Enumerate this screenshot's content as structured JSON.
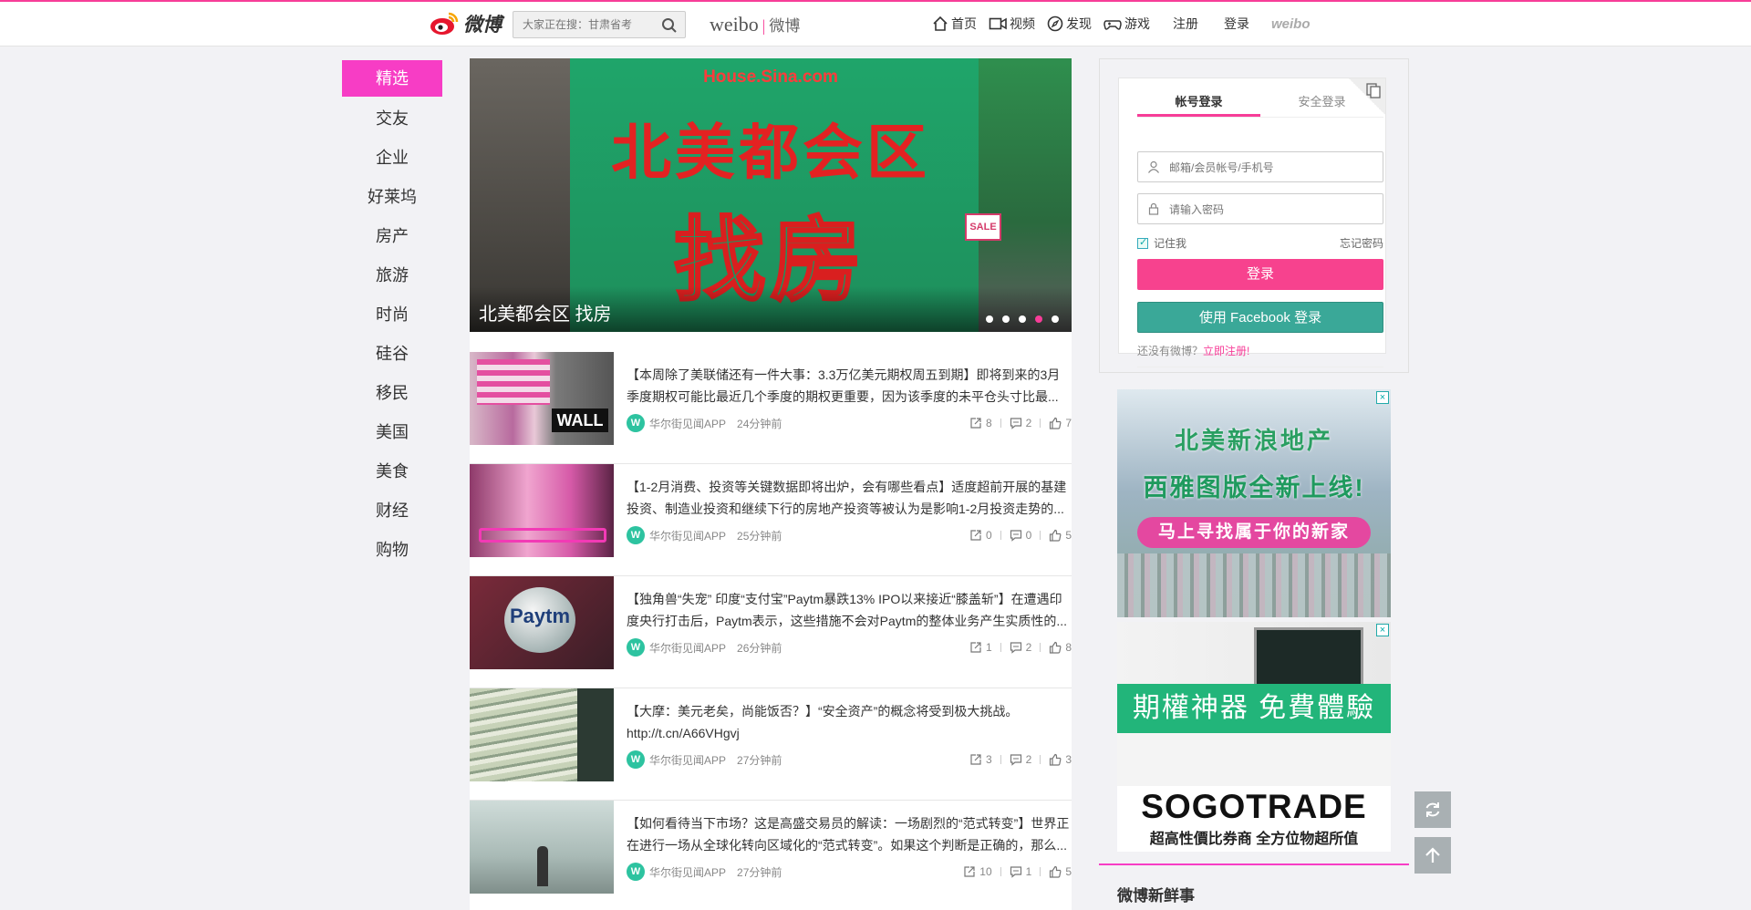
{
  "header": {
    "logo_text": "微博",
    "search_placeholder": "大家正在搜：甘肃省考",
    "brand_en": "weibo",
    "brand_cn": "微博",
    "nav": [
      {
        "label": "首页",
        "icon": "home-icon"
      },
      {
        "label": "视频",
        "icon": "video-icon"
      },
      {
        "label": "发现",
        "icon": "compass-icon"
      },
      {
        "label": "游戏",
        "icon": "gamepad-icon"
      }
    ],
    "register": "注册",
    "login": "登录",
    "small_logo": "weibo"
  },
  "categories": [
    "精选",
    "交友",
    "企业",
    "好莱坞",
    "房产",
    "旅游",
    "时尚",
    "硅谷",
    "移民",
    "美国",
    "美食",
    "财经",
    "购物"
  ],
  "banner": {
    "site": "House.Sina.com",
    "title_line1": "北美都会区",
    "title_line2": "找房",
    "sale": "SALE",
    "caption": "北美都会区 找房",
    "dots": 5,
    "active_dot": 4
  },
  "feed": [
    {
      "text": "【本周除了美联储还有一件大事：3.3万亿美元期权周五到期】即将到来的3月季度期权可能比最近几个季度的期权更重要，因为该季度的未平仓头寸比最...",
      "source": "华尔街见闻APP",
      "time": "24分钟前",
      "reposts": "8",
      "comments": "2",
      "likes": "7",
      "thumb": "wall-street"
    },
    {
      "text": "【1-2月消费、投资等关键数据即将出炉，会有哪些看点】适度超前开展的基建投资、制造业投资和继续下行的房地产投资等被认为是影响1-2月投资走势的...",
      "source": "华尔街见闻APP",
      "time": "25分钟前",
      "reposts": "0",
      "comments": "0",
      "likes": "5",
      "thumb": "shopping-cart"
    },
    {
      "text": "【独角兽“失宠” 印度“支付宝”Paytm暴跌13% IPO以来接近“膝盖斩”】在遭遇印度央行打击后，Paytm表示，这些措施不会对Paytm的整体业务产生实质性的...",
      "source": "华尔街见闻APP",
      "time": "26分钟前",
      "reposts": "1",
      "comments": "2",
      "likes": "8",
      "thumb": "paytm"
    },
    {
      "text": "【大摩：美元老矣，尚能饭否？】“安全资产”的概念将受到极大挑战。http://t.cn/A66VHgvj",
      "source": "华尔街见闻APP",
      "time": "27分钟前",
      "reposts": "3",
      "comments": "2",
      "likes": "3",
      "thumb": "dollars"
    },
    {
      "text": "【如何看待当下市场？这是高盛交易员的解读：一场剧烈的“范式转变”】世界正在进行一场从全球化转向区域化的“范式转变”。如果这个判断是正确的，那么...",
      "source": "华尔街见闻APP",
      "time": "27分钟前",
      "reposts": "10",
      "comments": "1",
      "likes": "5",
      "thumb": "man-fog"
    }
  ],
  "login": {
    "tab_account": "帐号登录",
    "tab_secure": "安全登录",
    "user_placeholder": "邮箱/会员帐号/手机号",
    "pass_placeholder": "请输入密码",
    "remember": "记住我",
    "forgot": "忘记密码",
    "login_button": "登录",
    "facebook_button": "使用 Facebook 登录",
    "no_account": "还没有微博？",
    "register_link": "立即注册!"
  },
  "ads": {
    "ad1_line1": "北美新浪地产",
    "ad1_line2": "西雅图版全新上线!",
    "ad1_pill": "马上寻找属于你的新家",
    "ad2_band": "期權神器 免費體驗",
    "ad2_logo": "SOGOTRADE",
    "ad2_sub": "超高性價比券商 全方位物超所值",
    "close": "×"
  },
  "fresh_title": "微博新鲜事",
  "colors": {
    "accent": "#f73d98",
    "category_active": "#f73dc5",
    "facebook": "#3aa898"
  }
}
